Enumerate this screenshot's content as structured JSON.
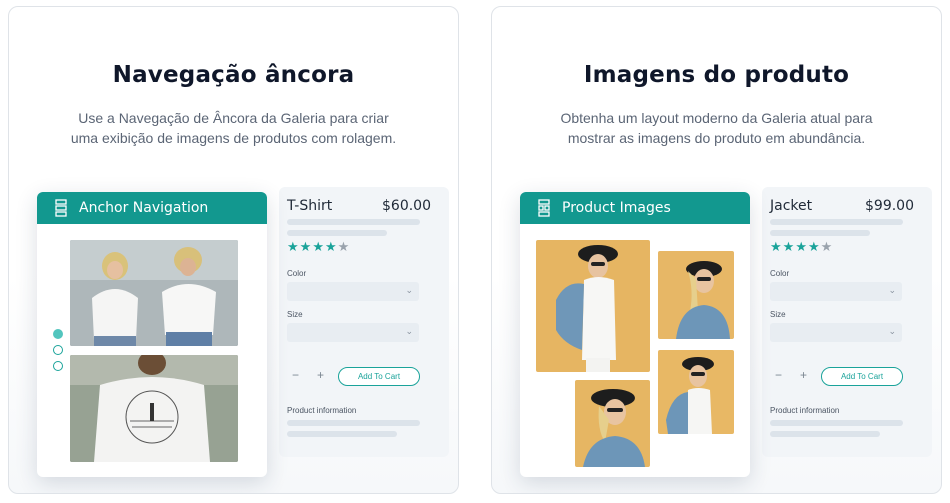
{
  "cards": [
    {
      "title": "Navegação âncora",
      "description": "Use a Navegação de Âncora da Galeria para criar uma exibição de imagens de produtos com rolagem.",
      "widget_title": "Anchor Navigation",
      "product": {
        "name": "T-Shirt",
        "price": "$60.00",
        "rating": 4,
        "rating_max": 5,
        "color_label": "Color",
        "size_label": "Size",
        "qty_minus": "−",
        "qty_plus": "+",
        "add_to_cart": "Add To Cart",
        "info_label": "Product information"
      }
    },
    {
      "title": "Imagens do produto",
      "description": "Obtenha um layout moderno da Galeria atual para mostrar as imagens do produto em abundância.",
      "widget_title": "Product Images",
      "product": {
        "name": "Jacket",
        "price": "$99.00",
        "rating": 4,
        "rating_max": 5,
        "color_label": "Color",
        "size_label": "Size",
        "qty_minus": "−",
        "qty_plus": "+",
        "add_to_cart": "Add To Cart",
        "info_label": "Product information"
      }
    }
  ],
  "colors": {
    "accent": "#12988f",
    "star_on": "#1aa39a",
    "star_off": "#9aa3ad"
  },
  "icons": {
    "widget_header_icon": "gallery-layout-icon",
    "chevron": "chevron-down-icon",
    "star": "star-icon"
  }
}
